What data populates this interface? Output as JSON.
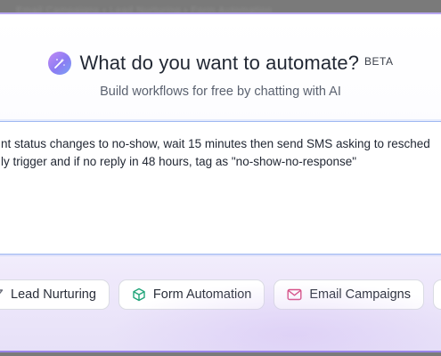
{
  "backdrop": {
    "text": "Email Campaigns • Lead Nurturing • Form Automation"
  },
  "header": {
    "title": "What do you want to automate?",
    "badge": "BETA",
    "subtitle": "Build workflows for free by chatting with AI",
    "logo_icon": "magic-wand-icon"
  },
  "prompt": {
    "value": "nt status changes to no-show, wait 15 minutes then send SMS asking to resched\nly trigger and if no reply in 48 hours, tag as \"no-show-no-response\""
  },
  "suggestions": [
    {
      "label": "Lead Nurturing",
      "icon": "funnel-icon",
      "icon_color": "#6b6f7a"
    },
    {
      "label": "Form Automation",
      "icon": "cube-icon",
      "icon_color": "#22a57a"
    },
    {
      "label": "Email Campaigns",
      "icon": "mail-icon",
      "icon_color": "#d6477e"
    },
    {
      "label": "",
      "icon": "chip-icon",
      "icon_color": "#6b6f7a"
    }
  ],
  "colors": {
    "accent": "#9a83ea",
    "input_border": "#9fb8f2",
    "text_primary": "#222834",
    "text_secondary": "#5b6270"
  }
}
